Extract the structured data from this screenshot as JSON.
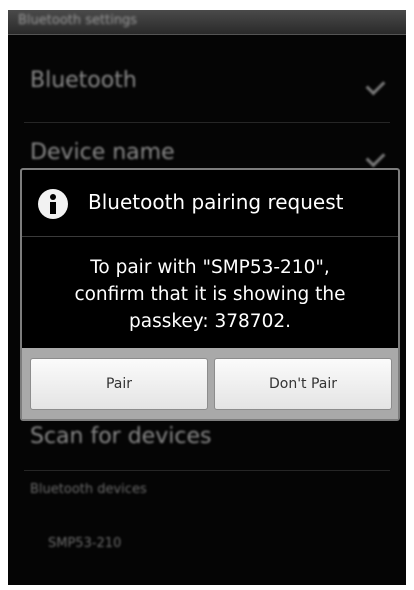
{
  "statusbar": {
    "title": "Bluetooth settings"
  },
  "settings": [
    {
      "label": "Bluetooth",
      "checked": true
    },
    {
      "label": "Device name",
      "checked": true
    }
  ],
  "background_lower": {
    "scan_label": "Scan for devices",
    "section_label": "Bluetooth devices",
    "device_label": "SMP53-210"
  },
  "dialog": {
    "icon": "info-icon",
    "title": "Bluetooth pairing request",
    "message_lines": [
      "To pair with \"SMP53-210\",",
      "confirm that it is showing the",
      "passkey: 378702."
    ],
    "buttons": {
      "pair": "Pair",
      "dont_pair": "Don't Pair"
    }
  },
  "colors": {
    "background": "#050505",
    "dialog_border": "#7d7d7d",
    "button_bar": "#a9a9a9",
    "button_text": "#333333"
  }
}
